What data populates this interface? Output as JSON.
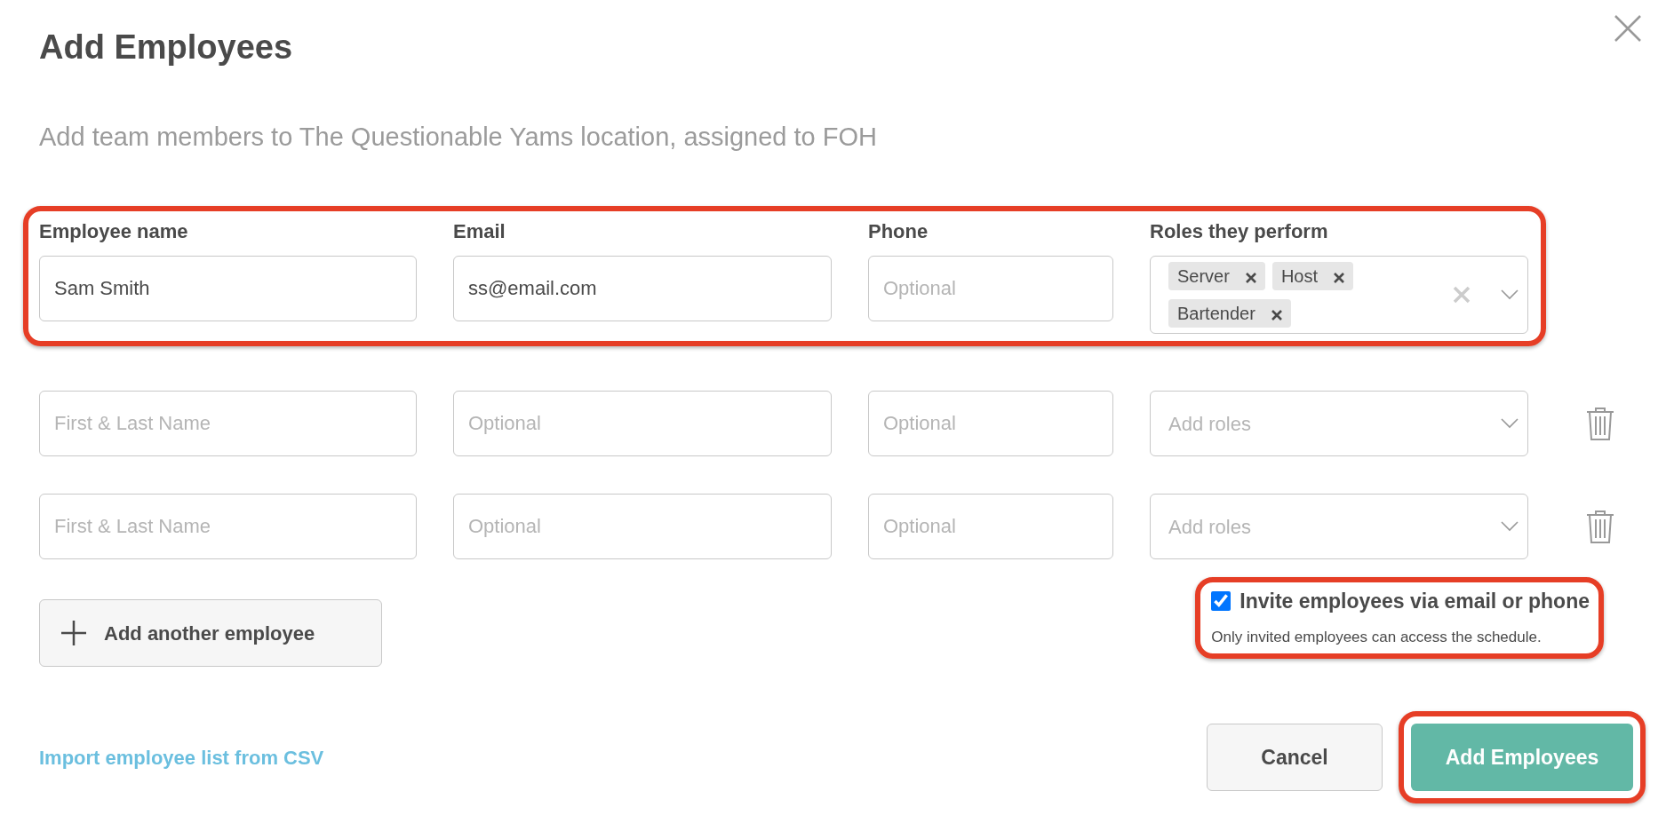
{
  "dialog": {
    "title": "Add Employees",
    "subtitle": "Add team members to The Questionable Yams location, assigned to FOH"
  },
  "columns": [
    "Employee name",
    "Email",
    "Phone",
    "Roles they perform"
  ],
  "rows": [
    {
      "highlighted": true,
      "removable": false,
      "name": {
        "value": "Sam Smith"
      },
      "email": {
        "value": "ss@email.com"
      },
      "phone": {
        "placeholder": "Optional"
      },
      "roles": {
        "tags": [
          "Server",
          "Host",
          "Bartender"
        ]
      }
    },
    {
      "highlighted": false,
      "removable": true,
      "name": {
        "placeholder": "First & Last Name"
      },
      "email": {
        "placeholder": "Optional"
      },
      "phone": {
        "placeholder": "Optional"
      },
      "roles": {
        "placeholder": "Add roles"
      }
    },
    {
      "highlighted": false,
      "removable": true,
      "name": {
        "placeholder": "First & Last Name"
      },
      "email": {
        "placeholder": "Optional"
      },
      "phone": {
        "placeholder": "Optional"
      },
      "roles": {
        "placeholder": "Add roles"
      }
    }
  ],
  "add_row_button": "Add another employee",
  "invite": {
    "label": "Invite employees via email or phone",
    "checked": true,
    "note": "Only invited employees can access the schedule.",
    "highlighted": true
  },
  "import_link": "Import employee list from CSV",
  "buttons": [
    {
      "kind": "secondary",
      "label": "Cancel",
      "highlighted": false
    },
    {
      "kind": "primary",
      "label": "Add Employees",
      "highlighted": true
    }
  ]
}
